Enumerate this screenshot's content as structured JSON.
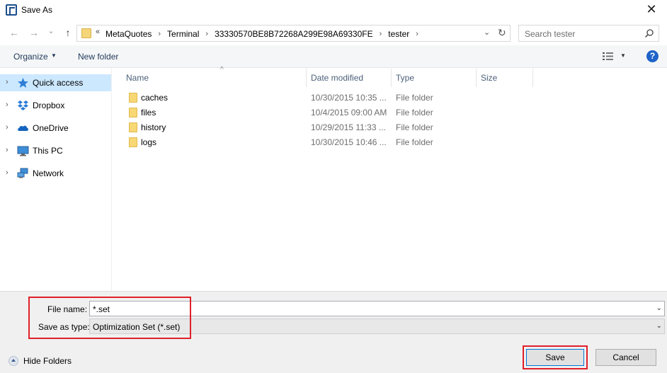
{
  "window": {
    "title": "Save As",
    "close_glyph": "✕"
  },
  "nav": {
    "back_glyph": "←",
    "forward_glyph": "→",
    "recent_glyph": "⌄",
    "up_glyph": "↑",
    "breadcrumb_prefix": "«",
    "breadcrumb_separator": "›",
    "breadcrumb": [
      "MetaQuotes",
      "Terminal",
      "33330570BE8B72268A299E98A69330FE",
      "tester"
    ],
    "dropdown_glyph": "⌄",
    "refresh_glyph": "↻"
  },
  "search": {
    "placeholder": "Search tester"
  },
  "toolbar": {
    "organize_label": "Organize",
    "organize_arrow": "▼",
    "new_folder_label": "New folder",
    "view_arrow": "▼",
    "help_label": "?"
  },
  "sidebar": {
    "expander_glyph": "›",
    "items": [
      {
        "label": "Quick access",
        "icon": "star-icon",
        "selected": true
      },
      {
        "label": "Dropbox",
        "icon": "dropbox-icon"
      },
      {
        "label": "OneDrive",
        "icon": "cloud-icon"
      },
      {
        "label": "This PC",
        "icon": "monitor-icon"
      },
      {
        "label": "Network",
        "icon": "network-icon"
      }
    ]
  },
  "files": {
    "sort_glyph": "^",
    "columns": [
      "Name",
      "Date modified",
      "Type",
      "Size"
    ],
    "rows": [
      {
        "name": "caches",
        "date": "10/30/2015 10:35 ...",
        "type": "File folder"
      },
      {
        "name": "files",
        "date": "10/4/2015 09:00 AM",
        "type": "File folder"
      },
      {
        "name": "history",
        "date": "10/29/2015 11:33 ...",
        "type": "File folder"
      },
      {
        "name": "logs",
        "date": "10/30/2015 10:46 ...",
        "type": "File folder"
      }
    ]
  },
  "form": {
    "file_name_label": "File name:",
    "file_name_value": "*.set",
    "save_type_label": "Save as type:",
    "save_type_value": "Optimization Set (*.set)",
    "dropdown_glyph": "⌄"
  },
  "footer": {
    "hide_folders_label": "Hide Folders",
    "save_label": "Save",
    "cancel_label": "Cancel"
  },
  "colors": {
    "highlight": "#e0202a",
    "selection": "#cce8ff",
    "accent": "#0078d7"
  }
}
